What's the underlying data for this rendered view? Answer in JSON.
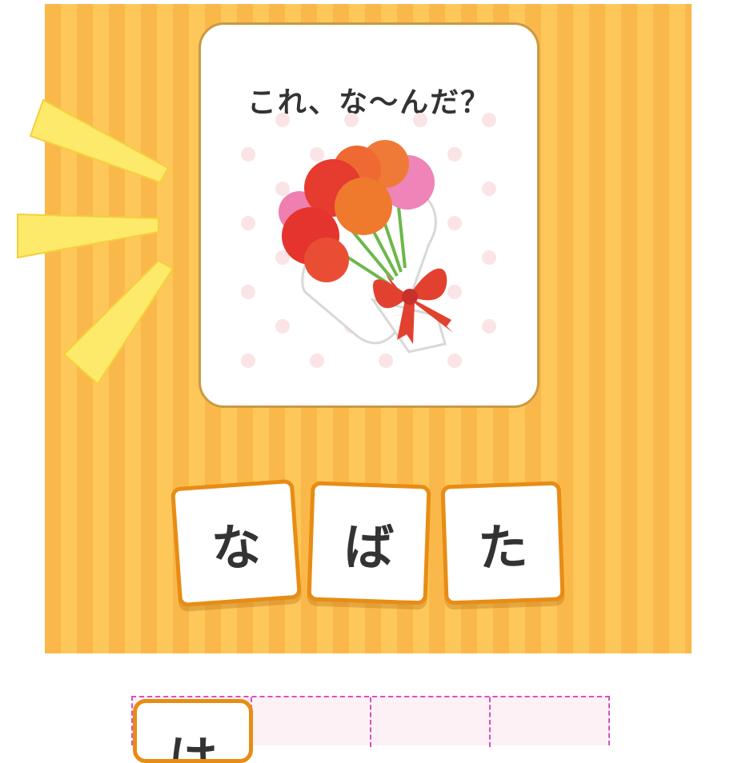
{
  "question": {
    "title": "これ、な〜んだ？",
    "picture": "carnation-bouquet-icon"
  },
  "choices": [
    {
      "label": "な"
    },
    {
      "label": "ば"
    },
    {
      "label": "た"
    }
  ],
  "answer": {
    "slots": 4,
    "filled": [
      {
        "label": "は"
      }
    ]
  },
  "colors": {
    "stripe_dark": "#fbb84a",
    "stripe_light": "#fdc75a",
    "tile_border": "#e88c14",
    "slot_border": "#d84fbf",
    "ray": "#fde96a"
  }
}
